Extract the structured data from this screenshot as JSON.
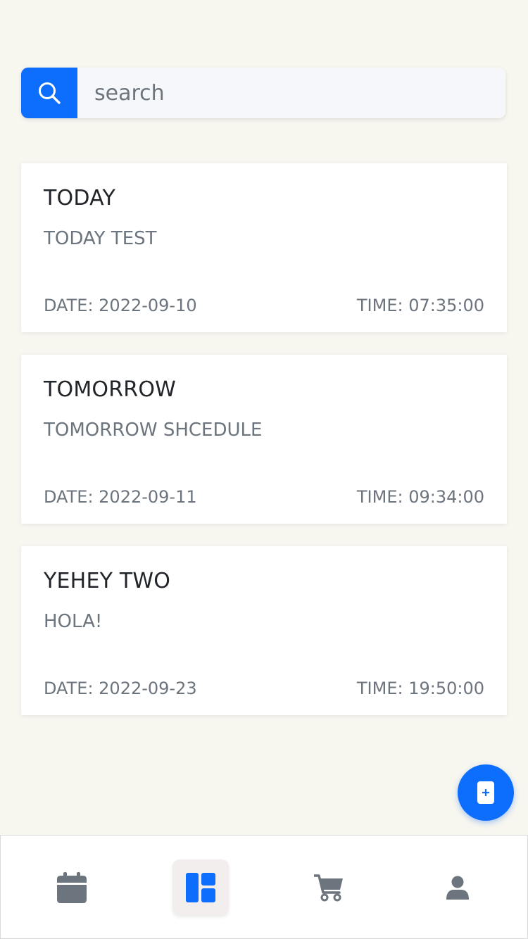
{
  "search": {
    "placeholder": "search"
  },
  "colors": {
    "accent": "#0d6efd",
    "icon_gray": "#6c757d",
    "background": "#f7f6ef"
  },
  "schedules": [
    {
      "title": "TODAY",
      "description": "TODAY TEST",
      "date_text": "DATE:  2022-09-10",
      "time_text": "TIME:  07:35:00"
    },
    {
      "title": "TOMORROW",
      "description": "TOMORROW SHCEDULE",
      "date_text": "DATE:  2022-09-11",
      "time_text": "TIME:  09:34:00"
    },
    {
      "title": "YEHEY TWO",
      "description": "HOLA!",
      "date_text": "DATE:  2022-09-23",
      "time_text": "TIME:  19:50:00"
    }
  ],
  "fab": {
    "icon": "add-note-icon"
  },
  "bottom_nav": {
    "items": [
      {
        "icon": "calendar-icon",
        "active": false
      },
      {
        "icon": "dashboard-icon",
        "active": true
      },
      {
        "icon": "cart-icon",
        "active": false
      },
      {
        "icon": "user-icon",
        "active": false
      }
    ]
  }
}
